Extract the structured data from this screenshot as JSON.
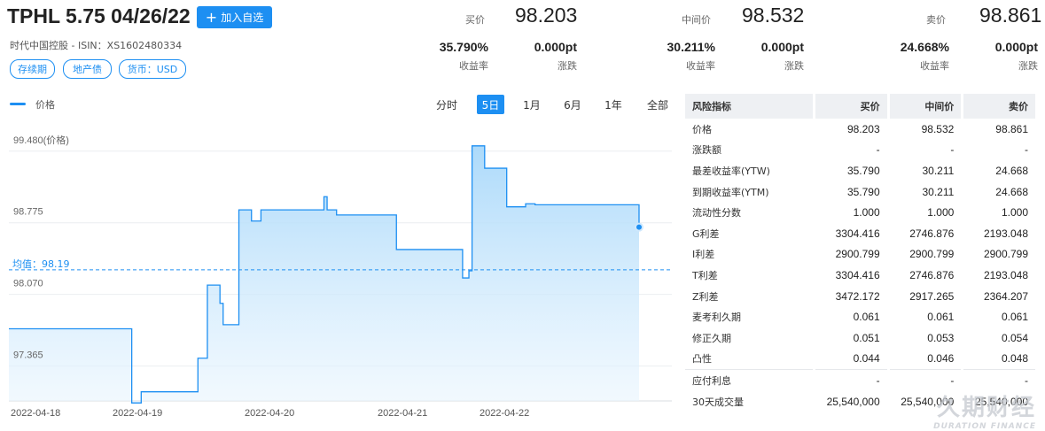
{
  "header": {
    "title": "TPHL 5.75 04/26/22",
    "add_button": "加入自选",
    "issuer_line": "时代中国控股 - ISIN：XS1602480334",
    "tags": [
      "存续期",
      "地产债",
      "货币：USD"
    ]
  },
  "quotes": {
    "bid": {
      "label": "买价",
      "price": "98.203",
      "yield": "35.790%",
      "yield_label": "收益率",
      "change": "0.000pt",
      "change_label": "涨跌"
    },
    "mid": {
      "label": "中间价",
      "price": "98.532",
      "yield": "30.211%",
      "yield_label": "收益率",
      "change": "0.000pt",
      "change_label": "涨跌"
    },
    "ask": {
      "label": "卖价",
      "price": "98.861",
      "yield": "24.668%",
      "yield_label": "收益率",
      "change": "0.000pt",
      "change_label": "涨跌"
    }
  },
  "chart_controls": {
    "legend": "价格",
    "ranges": [
      "分时",
      "5日",
      "1月",
      "6月",
      "1年",
      "全部"
    ],
    "active_range": "5日"
  },
  "chart_data": {
    "type": "area",
    "series": [
      {
        "name": "价格",
        "color": "#1d8ff2"
      }
    ],
    "y_ticks": [
      "99.480(价格)",
      "98.775",
      "98.070",
      "97.365"
    ],
    "ylim": [
      96.9,
      99.6
    ],
    "x_ticks": [
      "2022-04-18",
      "2022-04-19",
      "2022-04-20",
      "2022-04-21",
      "2022-04-22"
    ],
    "average_label": "均值：98.19",
    "average": 98.19,
    "steps": [
      [
        0,
        97.61
      ],
      [
        0.195,
        96.88
      ],
      [
        0.21,
        96.99
      ],
      [
        0.3,
        97.32
      ],
      [
        0.315,
        98.04
      ],
      [
        0.335,
        97.86
      ],
      [
        0.34,
        97.65
      ],
      [
        0.365,
        98.78
      ],
      [
        0.385,
        98.67
      ],
      [
        0.4,
        98.78
      ],
      [
        0.5,
        98.91
      ],
      [
        0.505,
        98.78
      ],
      [
        0.52,
        98.73
      ],
      [
        0.59,
        98.73
      ],
      [
        0.615,
        98.39
      ],
      [
        0.72,
        98.11
      ],
      [
        0.73,
        98.18
      ],
      [
        0.735,
        99.41
      ],
      [
        0.755,
        99.19
      ],
      [
        0.79,
        98.81
      ],
      [
        0.82,
        98.84
      ],
      [
        0.835,
        98.83
      ],
      [
        1.0,
        98.61
      ]
    ],
    "last_value": 98.61,
    "grid": "horizontal"
  },
  "risk": {
    "headers": [
      "风险指标",
      "买价",
      "中间价",
      "卖价"
    ],
    "rows": [
      [
        "价格",
        "98.203",
        "98.532",
        "98.861"
      ],
      [
        "涨跌额",
        "-",
        "-",
        "-"
      ],
      [
        "最差收益率(YTW)",
        "35.790",
        "30.211",
        "24.668"
      ],
      [
        "到期收益率(YTM)",
        "35.790",
        "30.211",
        "24.668"
      ],
      [
        "流动性分数",
        "1.000",
        "1.000",
        "1.000"
      ],
      [
        "G利差",
        "3304.416",
        "2746.876",
        "2193.048"
      ],
      [
        "I利差",
        "2900.799",
        "2900.799",
        "2900.799"
      ],
      [
        "T利差",
        "3304.416",
        "2746.876",
        "2193.048"
      ],
      [
        "Z利差",
        "3472.172",
        "2917.265",
        "2364.207"
      ],
      [
        "麦考利久期",
        "0.061",
        "0.061",
        "0.061"
      ],
      [
        "修正久期",
        "0.051",
        "0.053",
        "0.054"
      ],
      [
        "凸性",
        "0.044",
        "0.046",
        "0.048"
      ],
      [
        "应付利息",
        "-",
        "-",
        "-"
      ],
      [
        "30天成交量",
        "25,540,000",
        "25,540,000",
        "25,540,000"
      ]
    ]
  },
  "watermark": {
    "main": "久期财经",
    "sub": "DURATION FINANCE"
  }
}
